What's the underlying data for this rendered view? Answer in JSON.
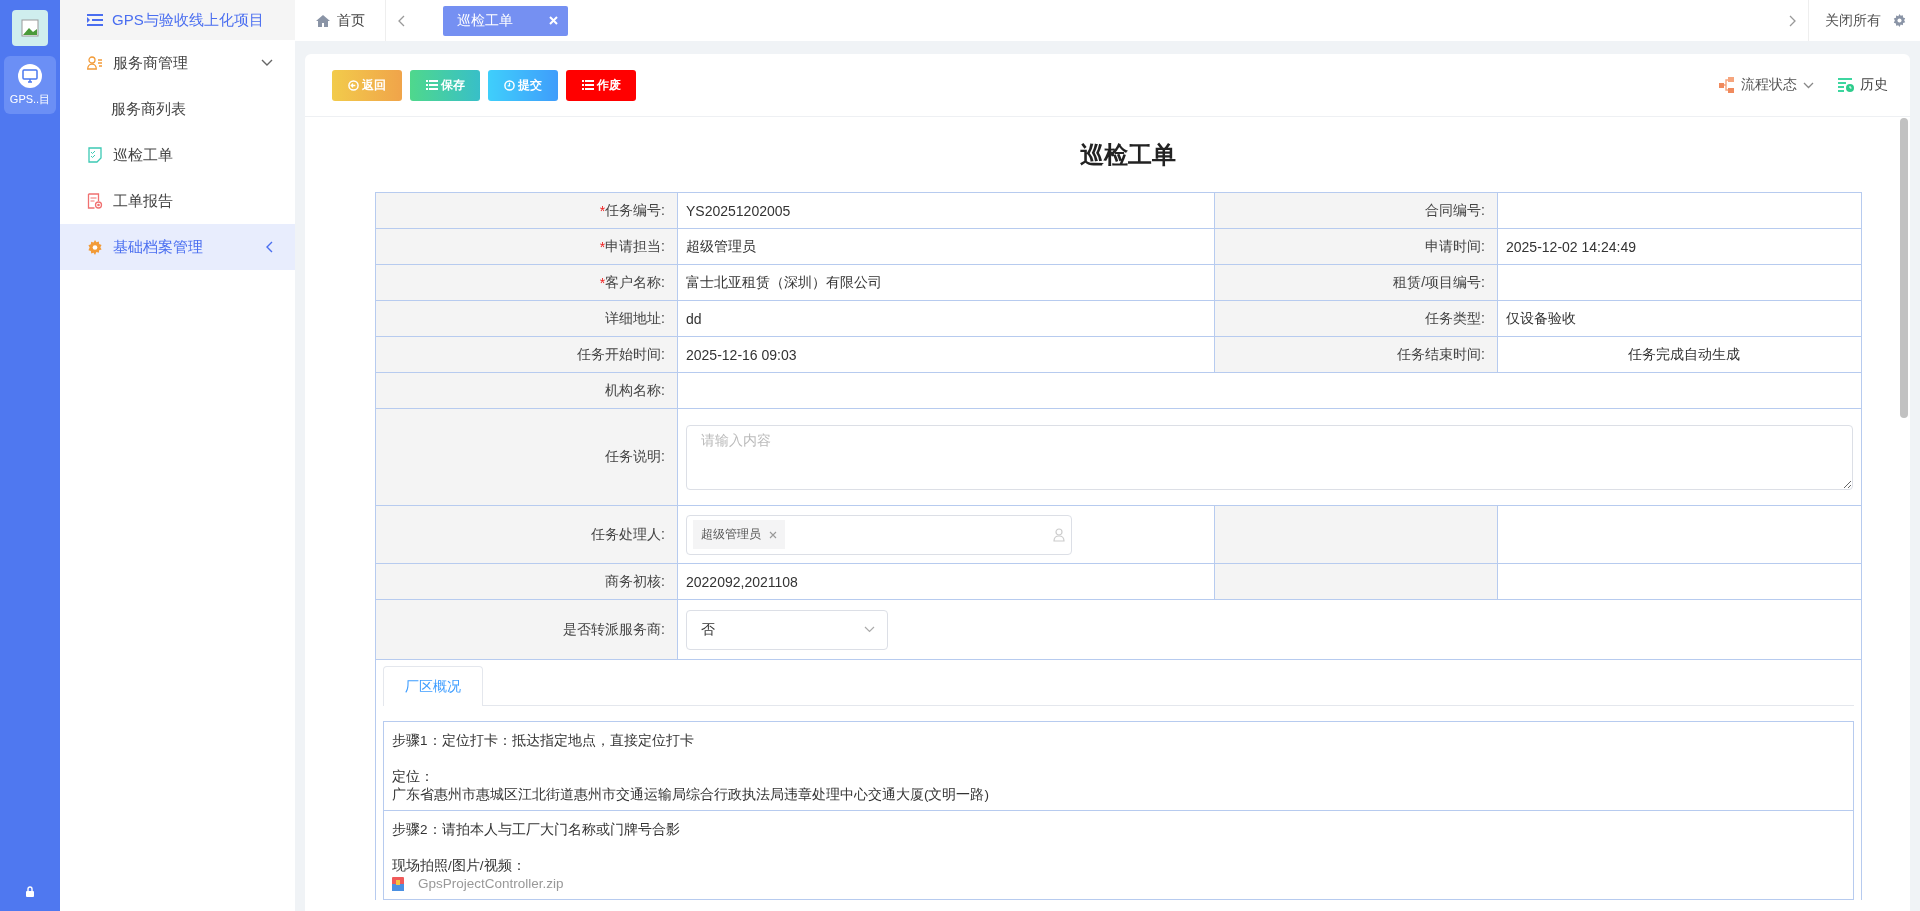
{
  "rail": {
    "app_label": "GPS..目",
    "app_selected": true
  },
  "sidebar": {
    "title": "GPS与验收线上化项目",
    "items": [
      {
        "label": "服务商管理",
        "selected": false,
        "expanded": true,
        "children": [
          {
            "label": "服务商列表",
            "selected": false
          }
        ]
      },
      {
        "label": "巡检工单",
        "selected": false
      },
      {
        "label": "工单报告",
        "selected": false
      },
      {
        "label": "基础档案管理",
        "selected": true,
        "expanded": false
      }
    ]
  },
  "tabs": [
    {
      "label": "首页",
      "kind": "home",
      "selected": false
    },
    {
      "label": "巡检工单",
      "kind": "page",
      "selected": true
    }
  ],
  "close_all": "关闭所有",
  "toolbar": {
    "buttons": [
      {
        "label": "返回",
        "kind": "back"
      },
      {
        "label": "保存",
        "kind": "save"
      },
      {
        "label": "提交",
        "kind": "submit"
      },
      {
        "label": "作废",
        "kind": "void"
      }
    ],
    "flow_status": "流程状态",
    "history": "历史"
  },
  "form": {
    "title": "巡检工单",
    "rows": [
      {
        "kind": "pair",
        "fields": [
          {
            "label": "任务编号:",
            "required_mark": "*",
            "value": "YS20251202005"
          },
          {
            "label": "合同编号:"
          }
        ]
      },
      {
        "kind": "pair",
        "fields": [
          {
            "label": "申请担当:",
            "required_mark": "*",
            "value": "超级管理员"
          },
          {
            "label": "申请时间:",
            "value": "2025-12-02 14:24:49"
          }
        ]
      },
      {
        "kind": "pair",
        "fields": [
          {
            "label": "客户名称:",
            "required_mark": "*",
            "value": "富士北亚租赁（深圳）有限公司"
          },
          {
            "label": "租赁/项目编号:"
          }
        ]
      },
      {
        "kind": "pair",
        "fields": [
          {
            "label": "详细地址:",
            "value": "dd"
          },
          {
            "label": "任务类型:",
            "value": "仅设备验收"
          }
        ]
      },
      {
        "kind": "pair",
        "fields": [
          {
            "label": "任务开始时间:",
            "value": "2025-12-16 09:03"
          },
          {
            "label": "任务结束时间:",
            "value": "任务完成自动生成",
            "note": true
          }
        ]
      },
      {
        "kind": "single",
        "label": "机构名称:"
      },
      {
        "kind": "textarea",
        "label": "任务说明:",
        "placeholder": "请输入内容"
      },
      {
        "kind": "tags",
        "label": "任务处理人:",
        "tags": [
          "超级管理员"
        ]
      },
      {
        "kind": "pair",
        "fields": [
          {
            "label": "商务初核:",
            "value": "2022092,2021108"
          }
        ]
      },
      {
        "kind": "select",
        "label": "是否转派服务商:",
        "value": "否"
      }
    ]
  },
  "section_tabs": [
    {
      "label": "厂区概况",
      "selected": true
    }
  ],
  "steps": [
    {
      "title": "步骤1：定位打卡：抵达指定地点，直接定位打卡",
      "label": "定位：",
      "kind": "location",
      "detail": "广东省惠州市惠城区江北街道惠州市交通运输局综合行政执法局违章处理中心交通大厦(文明一路)"
    },
    {
      "title": "步骤2：请拍本人与工厂大门名称或门牌号合影",
      "label": "现场拍照/图片/视频：",
      "kind": "file",
      "detail": "GpsProjectController.zip"
    }
  ]
}
